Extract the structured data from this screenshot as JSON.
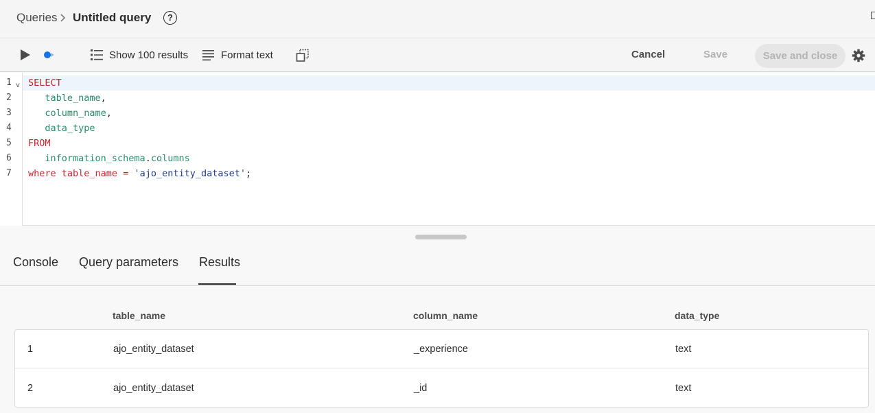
{
  "breadcrumb": {
    "parent": "Queries",
    "current": "Untitled query",
    "help_icon": "?"
  },
  "toolbar": {
    "run_icon": "play-icon",
    "run_selected_icon": "run-selected-icon",
    "show_results_label": "Show 100 results",
    "format_label": "Format text",
    "copy_icon": "copy-icon",
    "cancel_label": "Cancel",
    "save_label": "Save",
    "save_close_label": "Save and close",
    "settings_icon": "gear-icon"
  },
  "editor": {
    "line_numbers": [
      "1",
      "2",
      "3",
      "4",
      "5",
      "6",
      "7"
    ],
    "fold_marker": "v",
    "lines": {
      "l1_kw": "SELECT",
      "l2_id": "table_name",
      "l2_punct": ",",
      "l3_id": "column_name",
      "l3_punct": ",",
      "l4_id": "data_type",
      "l5_kw": "FROM",
      "l6_id": "information_schema",
      "l6_dot": ".",
      "l6_id2": "columns",
      "l7_kw1": "where",
      "l7_id": "table_name",
      "l7_op": "=",
      "l7_str": "'ajo_entity_dataset'",
      "l7_end": ";"
    }
  },
  "tabs": {
    "console": "Console",
    "params": "Query parameters",
    "results": "Results",
    "active": "Results"
  },
  "results": {
    "columns": [
      "table_name",
      "column_name",
      "data_type"
    ],
    "rows": [
      {
        "num": "1",
        "table_name": "ajo_entity_dataset",
        "column_name": "_experience",
        "data_type": "text"
      },
      {
        "num": "2",
        "table_name": "ajo_entity_dataset",
        "column_name": "_id",
        "data_type": "text"
      }
    ]
  },
  "colors": {
    "keyword": "#c9252d",
    "identifier": "#268e6c",
    "string": "#1e3a8a",
    "accent": "#2c2c2c",
    "disabled": "#b3b3b3"
  }
}
